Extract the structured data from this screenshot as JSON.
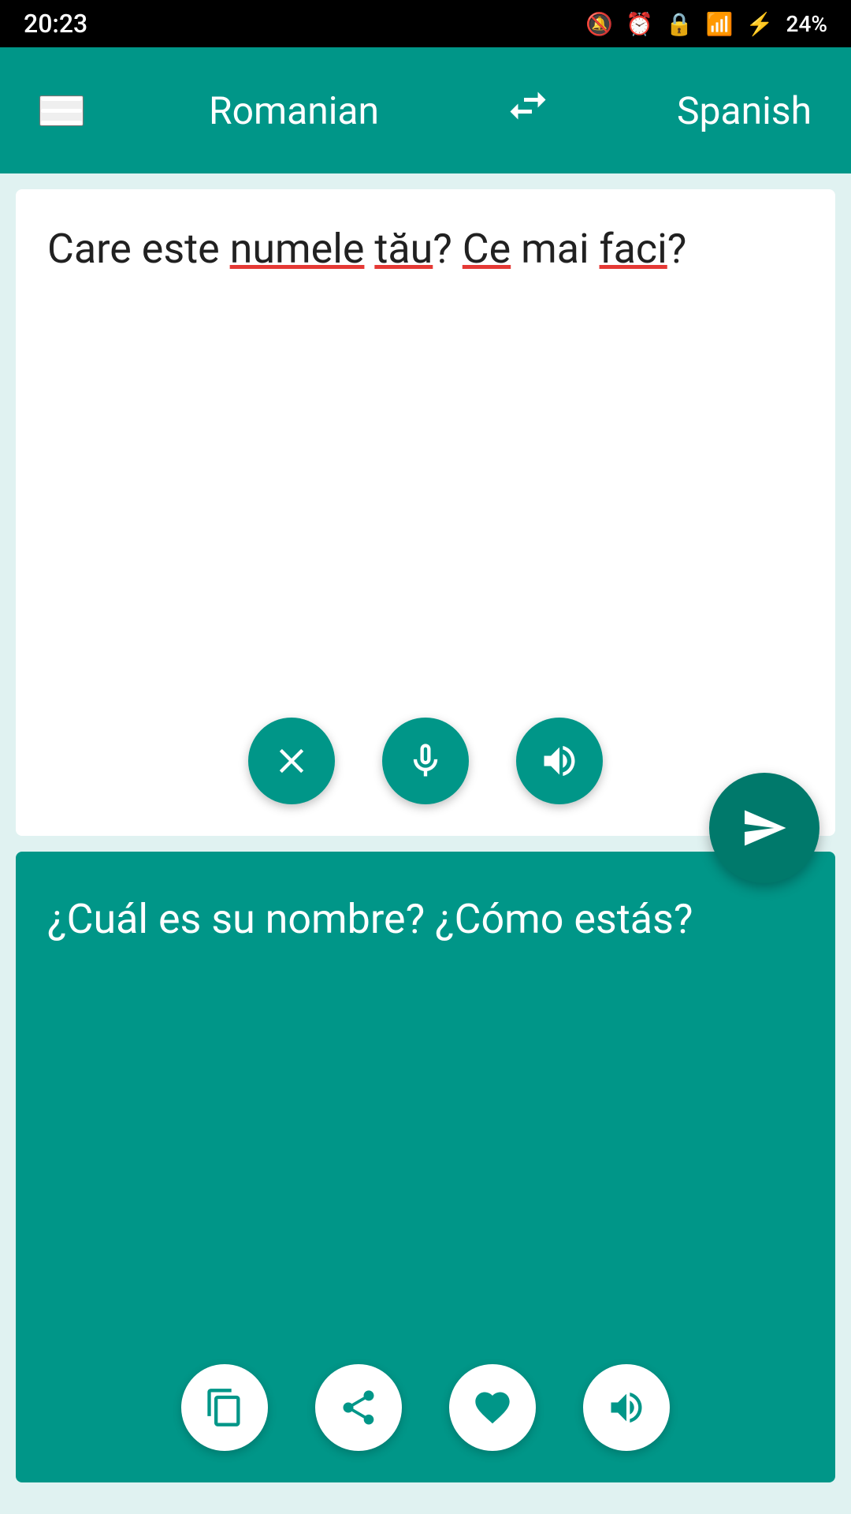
{
  "status": {
    "time": "20:23",
    "battery": "24%"
  },
  "header": {
    "source_lang": "Romanian",
    "target_lang": "Spanish",
    "menu_icon": "menu-icon",
    "swap_icon": "swap-icon"
  },
  "input": {
    "text_plain": "Care este numele tău? Ce mai faci?",
    "text_parts": [
      {
        "text": "Care este ",
        "underline": false
      },
      {
        "text": "numele",
        "underline": true
      },
      {
        "text": " ",
        "underline": false
      },
      {
        "text": "tău",
        "underline": true
      },
      {
        "text": "? ",
        "underline": false
      },
      {
        "text": "Ce",
        "underline": true
      },
      {
        "text": " mai ",
        "underline": false
      },
      {
        "text": "faci",
        "underline": true
      },
      {
        "text": "?",
        "underline": false
      }
    ],
    "clear_label": "clear",
    "mic_label": "microphone",
    "speak_label": "speaker"
  },
  "output": {
    "text": "¿Cuál es su nombre? ¿Cómo estás?",
    "copy_label": "copy",
    "share_label": "share",
    "favorite_label": "favorite",
    "speak_label": "speaker"
  },
  "send_label": "send"
}
